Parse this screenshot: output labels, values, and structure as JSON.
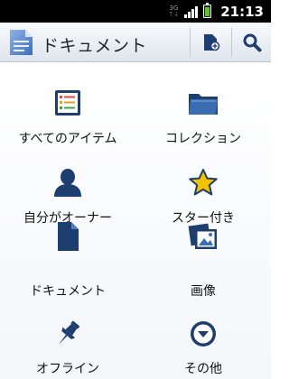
{
  "status_bar": {
    "network_type": "3G",
    "time": "21:13"
  },
  "action_bar": {
    "title": "ドキュメント",
    "actions": [
      {
        "icon": "new-document-icon"
      },
      {
        "icon": "search-icon"
      }
    ]
  },
  "menu": {
    "items": [
      {
        "label": "すべてのアイテム",
        "icon": "all-items-list-icon"
      },
      {
        "label": "コレクション",
        "icon": "folder-icon"
      },
      {
        "label": "自分がオーナー",
        "icon": "person-icon"
      },
      {
        "label": "スター付き",
        "icon": "star-icon"
      },
      {
        "label": "ドキュメント",
        "icon": "document-icon"
      },
      {
        "label": "画像",
        "icon": "images-icon"
      },
      {
        "label": "オフライン",
        "icon": "pin-icon"
      },
      {
        "label": "その他",
        "icon": "more-icon"
      }
    ]
  },
  "colors": {
    "accent_blue": "#1e4c8c",
    "star_yellow": "#f2c200",
    "battery_green": "#5fc231"
  }
}
